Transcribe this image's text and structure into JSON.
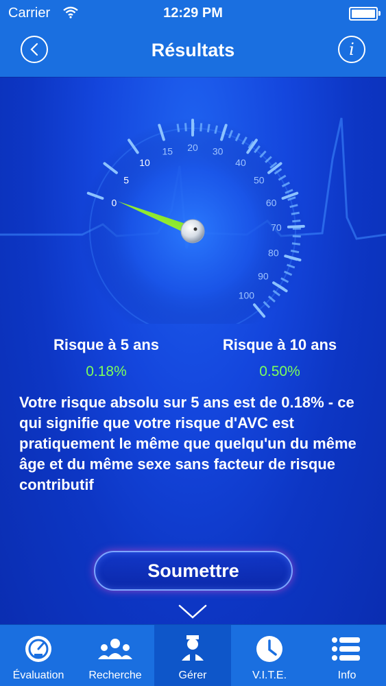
{
  "status": {
    "carrier": "Carrier",
    "time": "12:29 PM"
  },
  "nav": {
    "title": "Résultats",
    "info_label": "i"
  },
  "gauge": {
    "ticks": [
      "0",
      "5",
      "10",
      "15",
      "20",
      "30",
      "40",
      "50",
      "60",
      "70",
      "80",
      "90",
      "100"
    ],
    "needle_value_percent": 0.5,
    "needle_color": "#7CE82A"
  },
  "results": {
    "five_year": {
      "label": "Risque à 5 ans",
      "value": "0.18%"
    },
    "ten_year": {
      "label": "Risque à 10 ans",
      "value": "0.50%"
    },
    "value_color": "#7DFF5A"
  },
  "description": "Votre risque absolu sur 5 ans est de 0.18% - ce qui signifie que votre risque d'AVC est pratiquement le même que quelqu'un du même âge et du même sexe sans facteur de risque contributif",
  "submit_label": "Soumettre",
  "tabs": [
    {
      "label": "Évaluation",
      "icon": "gauge-icon"
    },
    {
      "label": "Recherche",
      "icon": "people-icon"
    },
    {
      "label": "Gérer",
      "icon": "doctor-icon",
      "active": true
    },
    {
      "label": "V.I.T.E.",
      "icon": "clock-icon"
    },
    {
      "label": "Info",
      "icon": "list-icon"
    }
  ],
  "colors": {
    "bar": "#1A6FE0",
    "background": "#1446DD",
    "active_tab": "#0E56C9"
  }
}
